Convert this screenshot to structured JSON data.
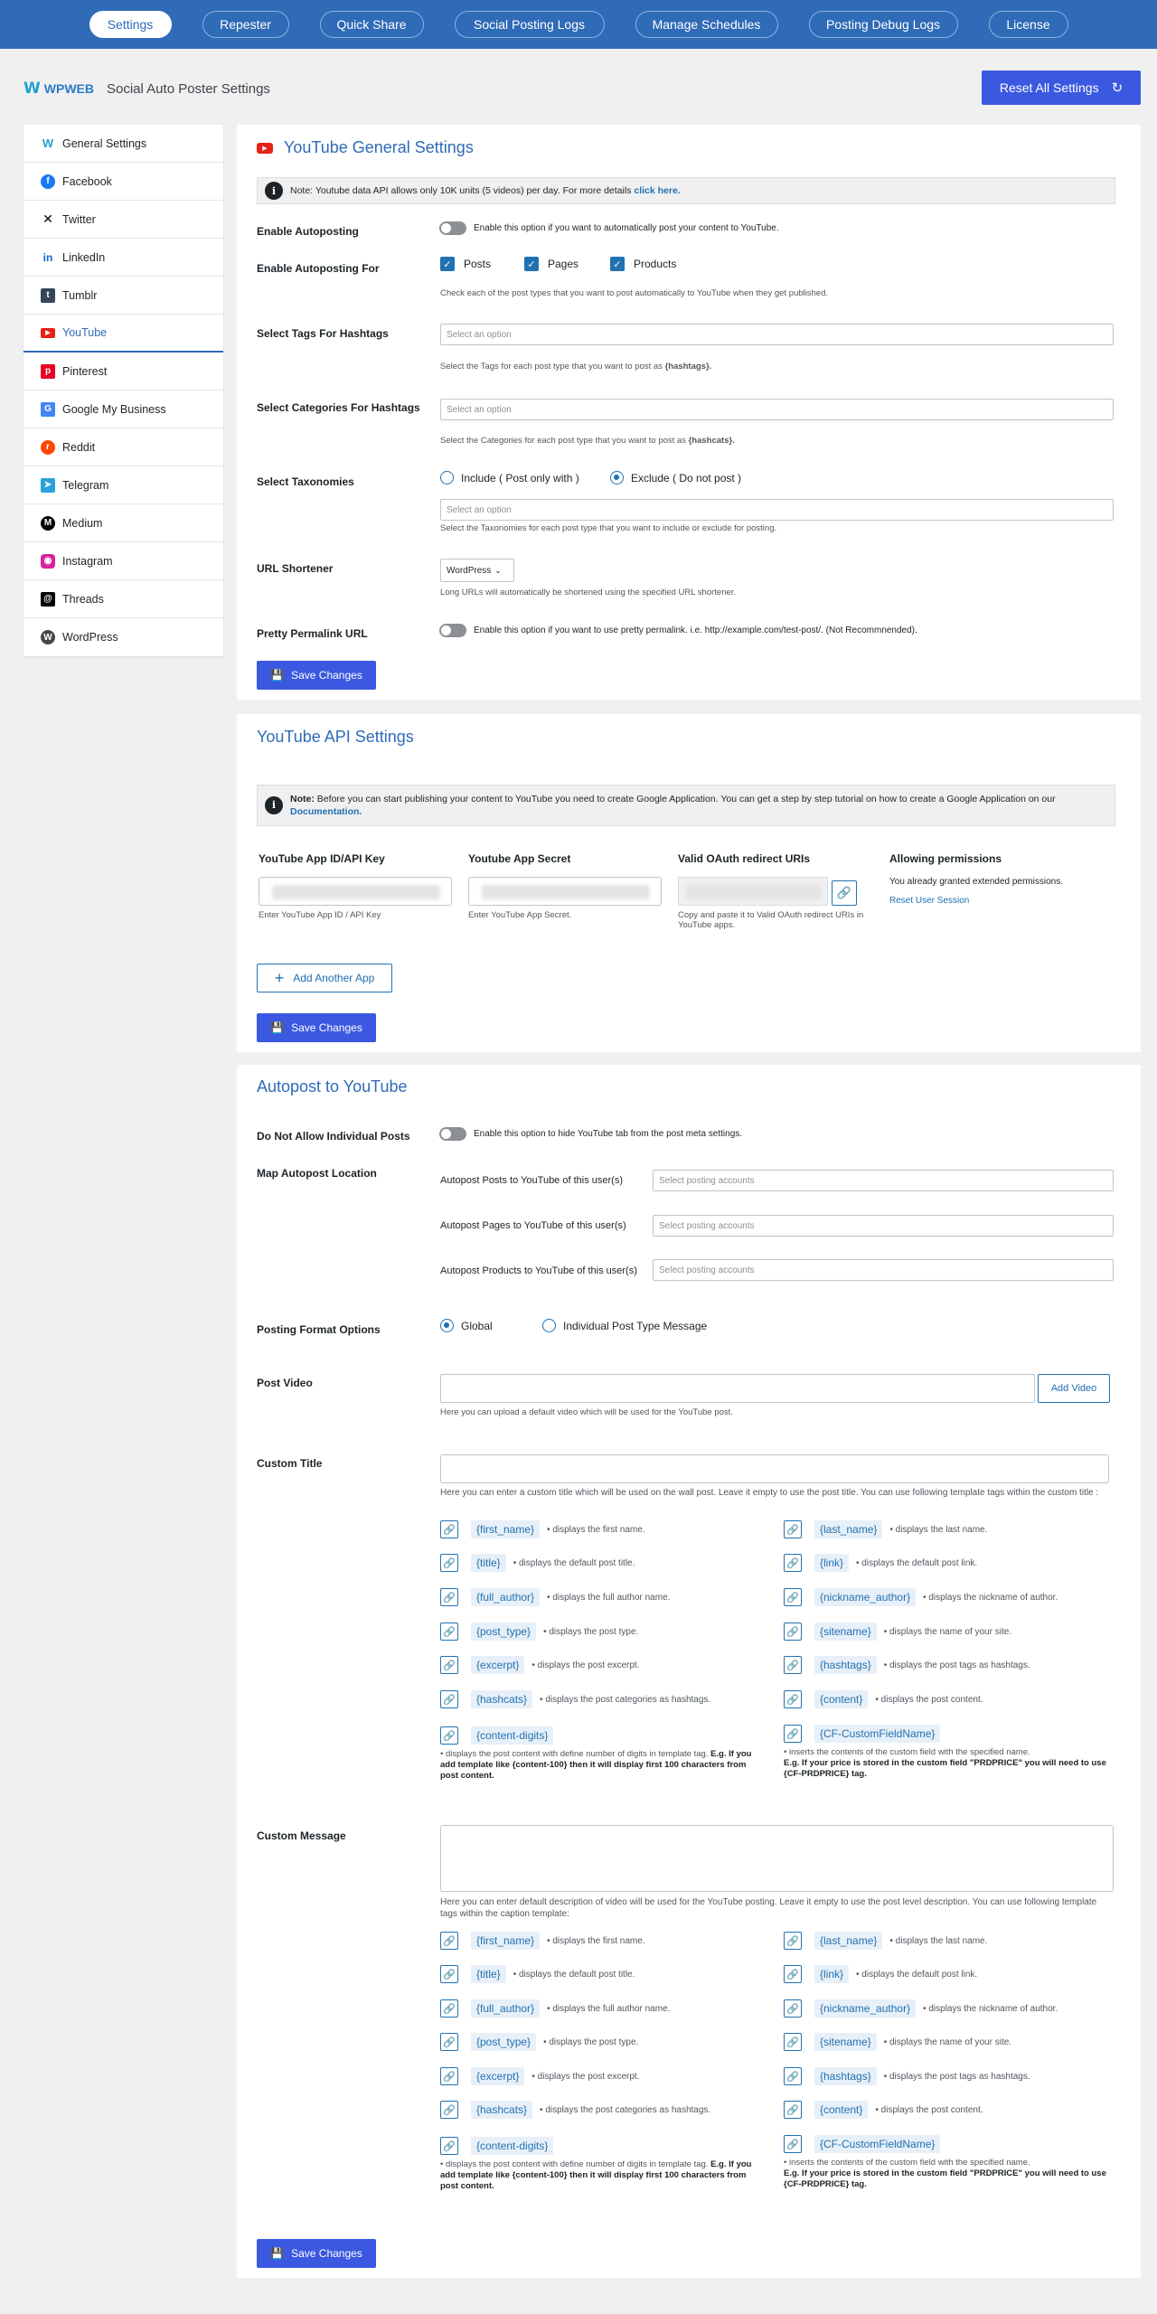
{
  "nav": {
    "tabs": [
      {
        "label": "Settings",
        "active": true
      },
      {
        "label": "Repester"
      },
      {
        "label": "Quick Share"
      },
      {
        "label": "Social Posting Logs"
      },
      {
        "label": "Manage Schedules"
      },
      {
        "label": "Posting Debug Logs"
      },
      {
        "label": "License"
      }
    ]
  },
  "header": {
    "logo_mark": "W",
    "logo_text": "WPWEB",
    "title": "Social Auto Poster Settings",
    "reset_button": "Reset All Settings"
  },
  "sidebar": {
    "items": [
      {
        "label": "General Settings",
        "icon": "wpweb-icon"
      },
      {
        "label": "Facebook",
        "icon": "facebook-icon"
      },
      {
        "label": "Twitter",
        "icon": "x-icon"
      },
      {
        "label": "LinkedIn",
        "icon": "linkedin-icon"
      },
      {
        "label": "Tumblr",
        "icon": "tumblr-icon"
      },
      {
        "label": "YouTube",
        "icon": "youtube-icon",
        "active": true
      },
      {
        "label": "Pinterest",
        "icon": "pinterest-icon"
      },
      {
        "label": "Google My Business",
        "icon": "google-my-business-icon"
      },
      {
        "label": "Reddit",
        "icon": "reddit-icon"
      },
      {
        "label": "Telegram",
        "icon": "telegram-icon"
      },
      {
        "label": "Medium",
        "icon": "medium-icon"
      },
      {
        "label": "Instagram",
        "icon": "instagram-icon"
      },
      {
        "label": "Threads",
        "icon": "threads-icon"
      },
      {
        "label": "WordPress",
        "icon": "wordpress-icon"
      }
    ]
  },
  "general": {
    "title": "YouTube General Settings",
    "notice_text": "Note: Youtube data API allows only 10K units (5 videos) per day. For more details ",
    "notice_link": "click here.",
    "enable_autoposting_label": "Enable Autoposting",
    "enable_autoposting_text": "Enable this option if you want to automatically post your content to YouTube.",
    "autoposting_for_label": "Enable Autoposting For",
    "post_types": [
      "Posts",
      "Pages",
      "Products"
    ],
    "post_types_help": "Check each of the post types that you want to post automatically to YouTube when they get published.",
    "tags_label": "Select Tags For Hashtags",
    "tags_placeholder": "Select an option",
    "tags_help_prefix": "Select the Tags for each post type that you want to post as ",
    "tags_help_code": "{hashtags}.",
    "cats_label": "Select Categories For Hashtags",
    "cats_placeholder": "Select an option",
    "cats_help_prefix": "Select the Categories for each post type that you want to post as ",
    "cats_help_code": "{hashcats}.",
    "tax_label": "Select Taxonomies",
    "tax_include": "Include ( Post only with )",
    "tax_exclude": "Exclude ( Do not post )",
    "tax_placeholder": "Select an option",
    "tax_help": "Select the Taxonomies for each post type that you want to include or exclude for posting.",
    "shortener_label": "URL Shortener",
    "shortener_value": "WordPress",
    "shortener_help": "Long URLs will automatically be shortened using the specified URL shortener.",
    "permalink_label": "Pretty Permalink URL",
    "permalink_text": "Enable this option if you want to use pretty permalink. i.e. http://example.com/test-post/. (Not Recommnended).",
    "save": "Save Changes"
  },
  "api": {
    "title": "YouTube API Settings",
    "notice_bold": "Note:",
    "notice_text": " Before you can start publishing your content to YouTube you need to create Google Application. You can get a step by step tutorial on how to create a Google Application on our ",
    "notice_link": "Documentation.",
    "col_key": "YouTube App ID/API Key",
    "col_secret": "Youtube App Secret",
    "col_redirect": "Valid OAuth redirect URIs",
    "col_permissions": "Allowing permissions",
    "key_help": "Enter YouTube App ID / API Key",
    "secret_help": "Enter YouTube App Secret.",
    "redirect_help": "Copy and paste it to Valid OAuth redirect URIs in YouTube apps.",
    "permissions_text": "You already granted extended permissions.",
    "reset_session": "Reset User Session",
    "add_app": "Add Another App",
    "save": "Save Changes"
  },
  "autopost": {
    "title": "Autopost to YouTube",
    "individual_label": "Do Not Allow Individual Posts",
    "individual_text": "Enable this option to hide YouTube tab from the post meta settings.",
    "map_label": "Map Autopost Location",
    "map_rows": [
      {
        "label": "Autopost Posts to YouTube of this user(s)",
        "placeholder": "Select posting accounts"
      },
      {
        "label": "Autopost Pages to YouTube of this user(s)",
        "placeholder": "Select posting accounts"
      },
      {
        "label": "Autopost Products to YouTube of this user(s)",
        "placeholder": "Select posting accounts"
      }
    ],
    "format_label": "Posting Format Options",
    "format_global": "Global",
    "format_individual": "Individual Post Type Message",
    "video_label": "Post Video",
    "add_video": "Add Video",
    "video_help": "Here you can upload a default video which will be used for the YouTube post.",
    "custom_title_label": "Custom Title",
    "custom_title_help": "Here you can enter a custom title which will be used on the wall post. Leave it empty to use the post title. You can use following template tags within the custom title :",
    "custom_message_label": "Custom Message",
    "custom_message_help": "Here you can enter default description of video will be used for the YouTube posting. Leave it empty to use the post level description. You can use following template tags within the caption template:",
    "tags_left": [
      {
        "tag": "{first_name}",
        "desc": "• displays the first name."
      },
      {
        "tag": "{title}",
        "desc": "• displays the default post title."
      },
      {
        "tag": "{full_author}",
        "desc": "• displays the full author name."
      },
      {
        "tag": "{post_type}",
        "desc": "• displays the post type."
      },
      {
        "tag": "{excerpt}",
        "desc": "• displays the post excerpt."
      },
      {
        "tag": "{hashcats}",
        "desc": "• displays the post categories as hashtags."
      },
      {
        "tag": "{content-digits}",
        "desc": ""
      }
    ],
    "tags_right": [
      {
        "tag": "{last_name}",
        "desc": "• displays the last name."
      },
      {
        "tag": "{link}",
        "desc": "• displays the default post link."
      },
      {
        "tag": "{nickname_author}",
        "desc": "• displays the nickname of author."
      },
      {
        "tag": "{sitename}",
        "desc": "• displays the name of your site."
      },
      {
        "tag": "{hashtags}",
        "desc": "• displays the post tags as hashtags."
      },
      {
        "tag": "{content}",
        "desc": "• displays the post content."
      },
      {
        "tag": "{CF-CustomFieldName}",
        "desc": ""
      }
    ],
    "digits_note": "• displays the post content with define number of digits in template tag. ",
    "digits_note_bold": "E.g. If you add template like {content-100} then it will display first 100 characters from post content.",
    "cf_note": "• inserts the contents of the custom field with the specified name.",
    "cf_note_bold": "E.g. If your price is stored in the custom field \"PRDPRICE\" you will need to use {CF-PRDPRICE} tag.",
    "save": "Save Changes"
  }
}
